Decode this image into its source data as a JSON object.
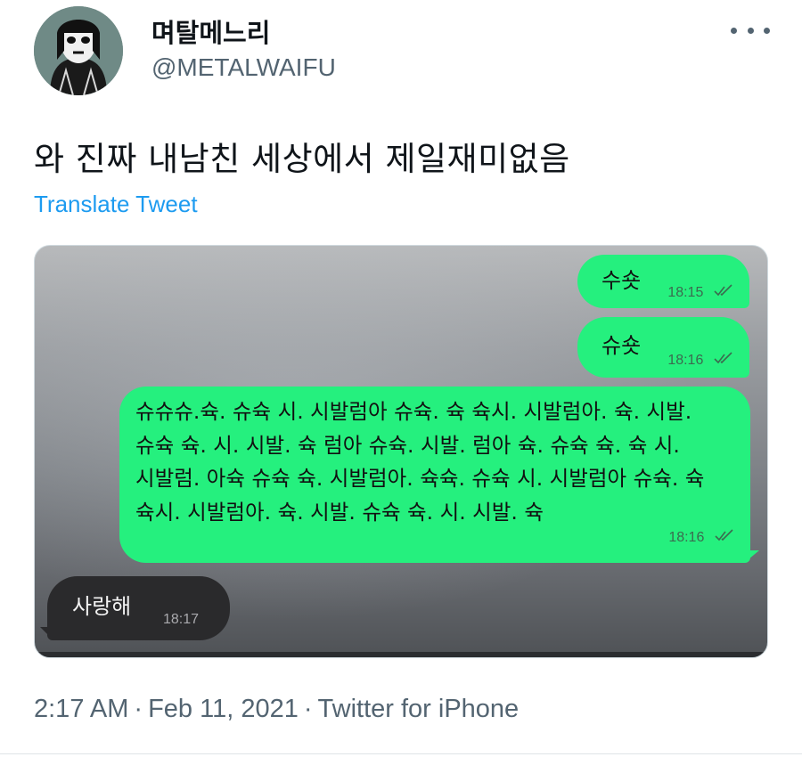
{
  "author": {
    "display_name": "며탈메느리",
    "handle": "@METALWAIFU"
  },
  "tweet": {
    "text": "와 진짜 내남친 세상에서 제일재미없음",
    "translate_label": "Translate Tweet",
    "time": "2:17 AM",
    "separator": "·",
    "date": "Feb 11, 2021",
    "source": "Twitter for iPhone"
  },
  "chat": {
    "messages": [
      {
        "direction": "sent",
        "text": "수숏",
        "time": "18:15"
      },
      {
        "direction": "sent",
        "text": "슈숏",
        "time": "18:16"
      },
      {
        "direction": "sent",
        "text": "슈슈슈.슉. 슈슉 시. 시발럼아 슈슉. 슉 슉시. 시발럼아. 슉. 시발. 슈슉 슉. 시. 시발. 슉 럼아 슈슉. 시발. 럼아 슉. 슈슉 슉. 슉 시. 시발럼. 아슉 슈슉 슉. 시발럼아. 슉슉. 슈슉 시. 시발럼아 슈슉. 슉 슉시. 시발럼아. 슉. 시발. 슈슉 슉. 시. 시발. 슉",
        "time": "18:16"
      },
      {
        "direction": "received",
        "text": "사랑해",
        "time": "18:17"
      }
    ]
  },
  "icons": {
    "more": "more-horizontal-icon",
    "read": "double-check-icon"
  },
  "colors": {
    "link": "#1d9bf0",
    "sent_bubble": "#25f07e",
    "received_bubble": "#2a2a2c",
    "muted_text": "#536471"
  }
}
